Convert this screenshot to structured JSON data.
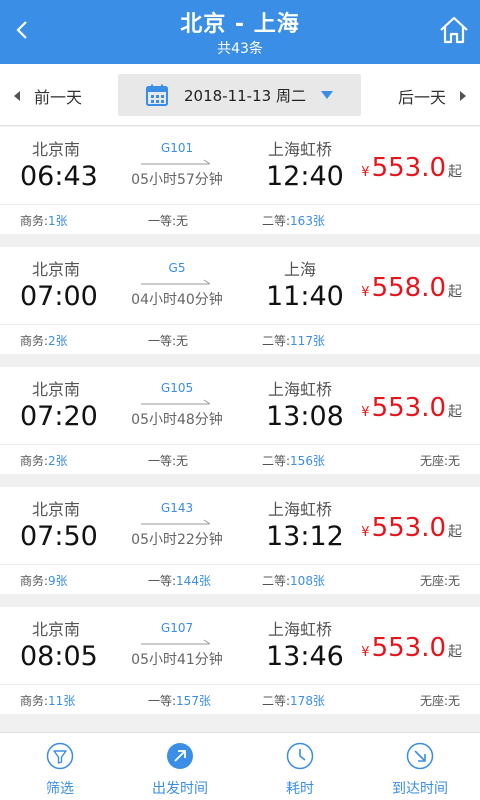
{
  "header": {
    "title": "北京 - 上海",
    "subtitle": "共43条",
    "back_icon": "chevron-left-icon",
    "home_icon": "home-icon"
  },
  "datebar": {
    "prev_label": "前一天",
    "date_label": "2018-11-13 周二",
    "next_label": "后一天",
    "calendar_icon": "calendar-icon"
  },
  "trains": [
    {
      "from": "北京南",
      "dep": "06:43",
      "train": "G101",
      "duration": "05小时57分钟",
      "to": "上海虹桥",
      "arr": "12:40",
      "yen": "¥",
      "price": "553.0",
      "qi": "起",
      "biz_label": "商务:",
      "biz_val": "1张",
      "first_label": "一等:",
      "first_val": "无",
      "second_label": "二等:",
      "second_val": "163张",
      "none_label": "",
      "none_val": ""
    },
    {
      "from": "北京南",
      "dep": "07:00",
      "train": "G5",
      "duration": "04小时40分钟",
      "to": "上海",
      "arr": "11:40",
      "yen": "¥",
      "price": "558.0",
      "qi": "起",
      "biz_label": "商务:",
      "biz_val": "2张",
      "first_label": "一等:",
      "first_val": "无",
      "second_label": "二等:",
      "second_val": "117张",
      "none_label": "",
      "none_val": ""
    },
    {
      "from": "北京南",
      "dep": "07:20",
      "train": "G105",
      "duration": "05小时48分钟",
      "to": "上海虹桥",
      "arr": "13:08",
      "yen": "¥",
      "price": "553.0",
      "qi": "起",
      "biz_label": "商务:",
      "biz_val": "2张",
      "first_label": "一等:",
      "first_val": "无",
      "second_label": "二等:",
      "second_val": "156张",
      "none_label": "无座:",
      "none_val": "无"
    },
    {
      "from": "北京南",
      "dep": "07:50",
      "train": "G143",
      "duration": "05小时22分钟",
      "to": "上海虹桥",
      "arr": "13:12",
      "yen": "¥",
      "price": "553.0",
      "qi": "起",
      "biz_label": "商务:",
      "biz_val": "9张",
      "first_label": "一等:",
      "first_val": "144张",
      "second_label": "二等:",
      "second_val": "108张",
      "none_label": "无座:",
      "none_val": "无"
    },
    {
      "from": "北京南",
      "dep": "08:05",
      "train": "G107",
      "duration": "05小时41分钟",
      "to": "上海虹桥",
      "arr": "13:46",
      "yen": "¥",
      "price": "553.0",
      "qi": "起",
      "biz_label": "商务:",
      "biz_val": "11张",
      "first_label": "一等:",
      "first_val": "157张",
      "second_label": "二等:",
      "second_val": "178张",
      "none_label": "无座:",
      "none_val": "无"
    }
  ],
  "tabbar": {
    "items": [
      {
        "label": "筛选",
        "icon": "filter-icon"
      },
      {
        "label": "出发时间",
        "icon": "arrow-up-right-icon"
      },
      {
        "label": "耗时",
        "icon": "clock-icon"
      },
      {
        "label": "到达时间",
        "icon": "arrow-down-right-icon"
      }
    ]
  },
  "colors": {
    "accent": "#3a8ee6",
    "price": "#e8141c",
    "background": "#f0f0f0"
  }
}
